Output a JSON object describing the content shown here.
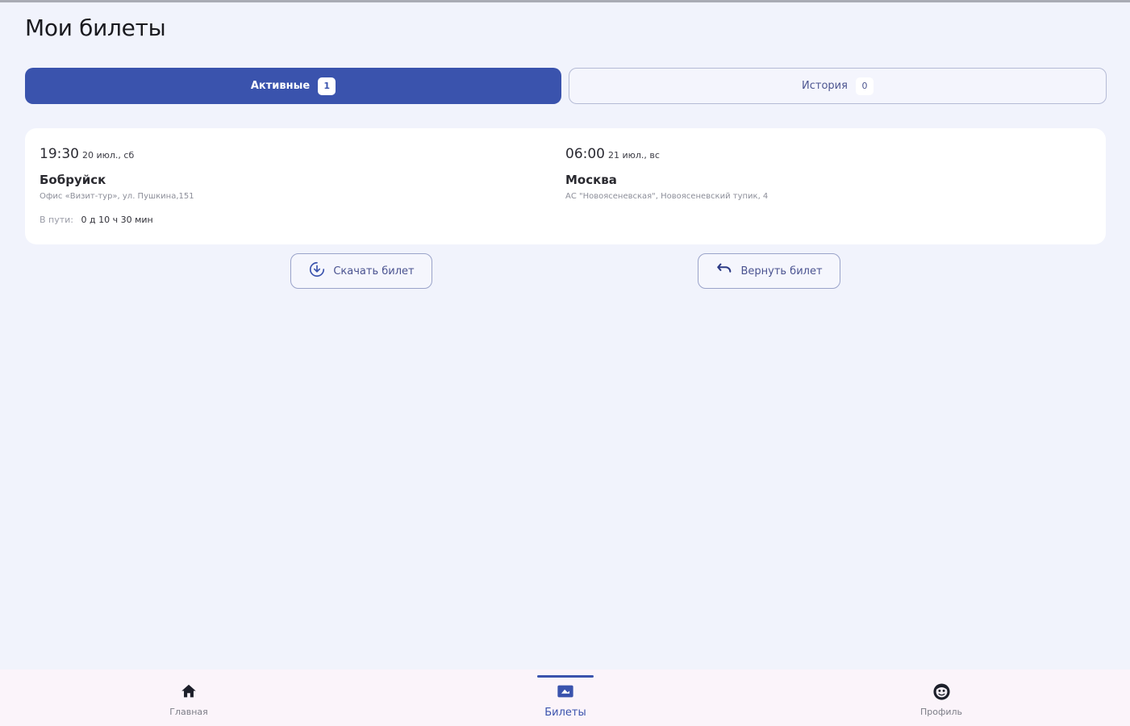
{
  "page": {
    "title": "Мои билеты"
  },
  "tabs": {
    "active": {
      "label": "Активные",
      "count": "1"
    },
    "history": {
      "label": "История",
      "count": "0"
    }
  },
  "ticket": {
    "departure": {
      "time": "19:30",
      "date": "20 июл., сб",
      "city": "Бобруйск",
      "address": "Офис «Визит-тур», ул. Пушкина,151"
    },
    "arrival": {
      "time": "06:00",
      "date": "21 июл., вс",
      "city": "Москва",
      "address": "АС \"Новоясеневская\", Новоясеневский тупик, 4"
    },
    "duration": {
      "label": "В пути:",
      "value": "0 д 10 ч 30 мин"
    }
  },
  "actions": {
    "download_label": "Скачать билет",
    "return_label": "Вернуть билет"
  },
  "nav": {
    "home_label": "Главная",
    "tickets_label": "Билеты",
    "profile_label": "Профиль"
  },
  "colors": {
    "accent": "#3a53ad",
    "background": "#f1f3fc",
    "card": "#ffffff",
    "nav_background": "#fbf4fa"
  },
  "icons": {
    "download": "download-circle-icon",
    "return": "undo-icon",
    "home": "home-icon",
    "tickets": "ticket-icon",
    "profile": "profile-face-icon"
  }
}
